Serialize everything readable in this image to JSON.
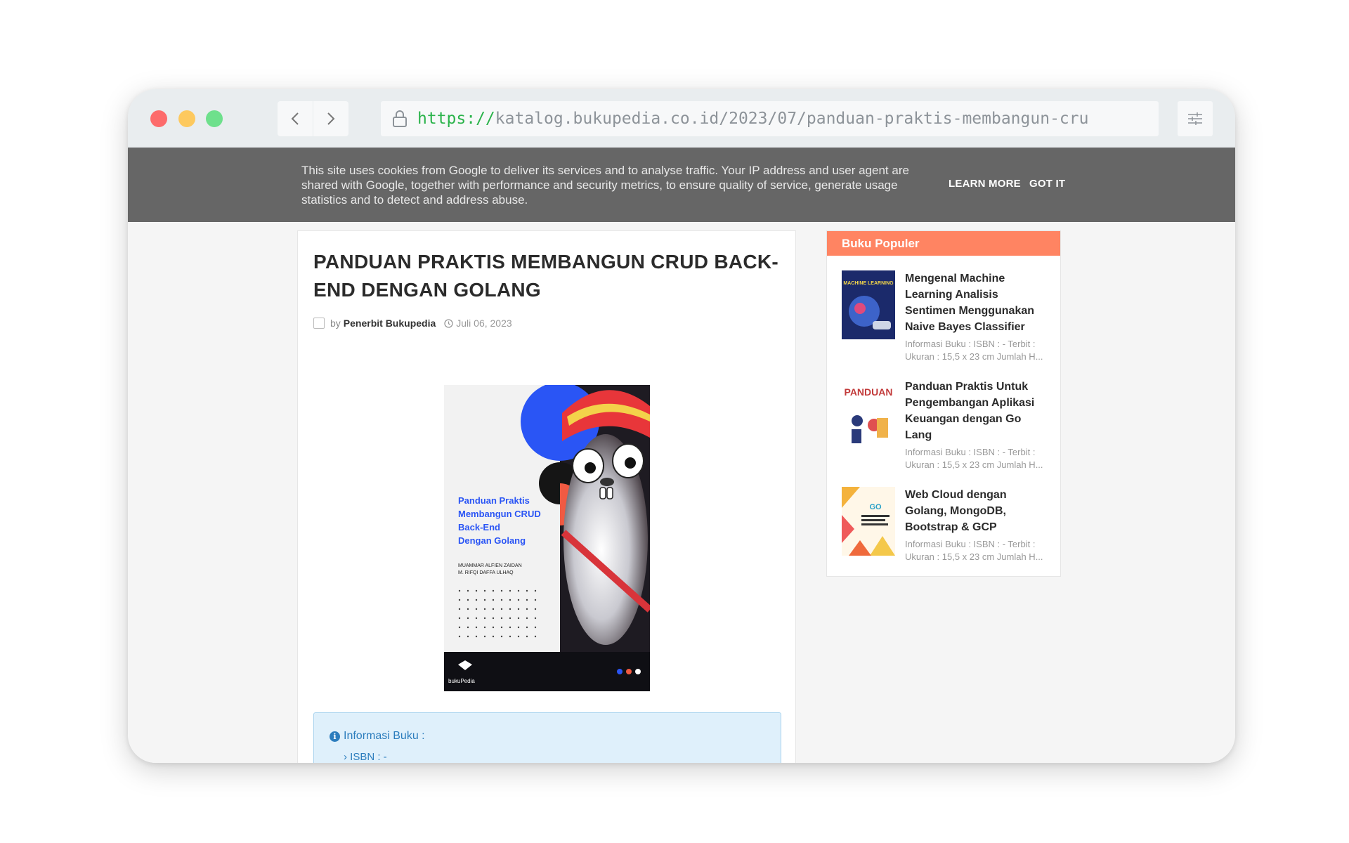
{
  "browser": {
    "url_protocol": "https://",
    "url_rest": "katalog.bukupedia.co.id/2023/07/panduan-praktis-membangun-cru"
  },
  "cookie_bar": {
    "message": "This site uses cookies from Google to deliver its services and to analyse traffic. Your IP address and user agent are shared with Google, together with performance and security metrics, to ensure quality of service, generate usage statistics and to detect and address abuse.",
    "learn_more": "LEARN MORE",
    "got_it": "GOT IT"
  },
  "post": {
    "title": "PANDUAN PRAKTIS MEMBANGUN CRUD BACK-END DENGAN GOLANG",
    "by_label": "by",
    "author": "Penerbit Bukupedia",
    "date": "Juli 06, 2023",
    "cover": {
      "title_lines": [
        "Panduan Praktis",
        "Membangun CRUD",
        "Back-End",
        "Dengan Golang"
      ],
      "authors": [
        "MUAMMAR ALFIEN ZAIDAN",
        "M. RIFQI DAFFA ULHAQ"
      ],
      "publisher": "bukuPedia"
    },
    "info": {
      "heading": "Informasi Buku :",
      "first_item": "ISBN : -"
    }
  },
  "sidebar": {
    "heading": "Buku Populer",
    "items": [
      {
        "title": "Mengenal Machine Learning Analisis Sentimen Menggunakan Naive Bayes Classifier",
        "desc": "Informasi Buku : ISBN : - Terbit : Ukuran : 15,5 x 23 cm Jumlah H...",
        "thumb_text": "MACHINE LEARNING"
      },
      {
        "title": "Panduan Praktis Untuk Pengembangan Aplikasi Keuangan dengan Go Lang",
        "desc": "Informasi Buku : ISBN : - Terbit : Ukuran : 15,5 x 23 cm Jumlah H...",
        "thumb_text": "PANDUAN"
      },
      {
        "title": "Web Cloud dengan Golang, MongoDB, Bootstrap & GCP",
        "desc": "Informasi Buku : ISBN : - Terbit : Ukuran : 15,5 x 23 cm Jumlah H...",
        "thumb_text": "GO"
      }
    ]
  },
  "colors": {
    "accent": "#ff8462",
    "cookie_bar": "#666666",
    "info_text": "#2c7dbd",
    "url_protocol": "#2bb34b"
  }
}
